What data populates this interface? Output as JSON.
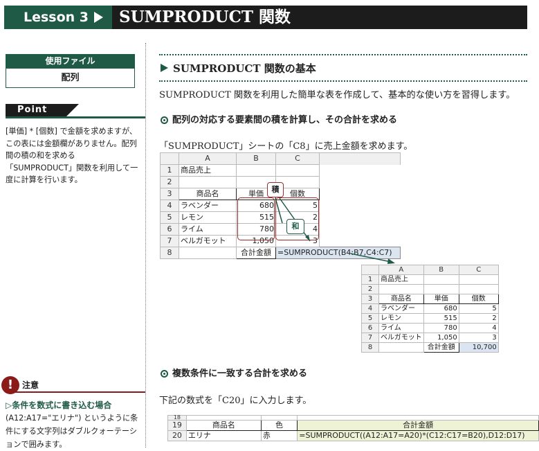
{
  "header": {
    "lesson": "Lesson 3",
    "title": "SUMPRODUCT 関数"
  },
  "sidebar": {
    "file_head": "使用ファイル",
    "file_name": "配列",
    "point_label": "Point",
    "point_text": "[単価] * [個数] で金額を求めますが、この表には金額欄がありません。配列間の積の和を求める「SUMPRODUCT」関数を利用して一度に計算を行います。",
    "caution_icon": "!",
    "caution_label": "注意",
    "caution_sub": "▷条件を数式に書き込む場合",
    "caution_text": "(A12:A17=\"エリナ\") というように条件にする文字列はダブルクォーテーションで囲みます。"
  },
  "main": {
    "section_title": "SUMPRODUCT 関数の基本",
    "intro": "SUMPRODUCT 関数を利用した簡単な表を作成して、基本的な使い方を習得します。",
    "sub1": "配列の対応する要素間の積を計算し、その合計を求める",
    "desc1": "「SUMPRODUCT」シートの「C8」に売上金額を求めます。",
    "sub2": "複数条件に一致する合計を求める",
    "desc2": "下記の数式を「C20」に入力します。"
  },
  "sheet1": {
    "cols": [
      "A",
      "B",
      "C"
    ],
    "title": "商品売上",
    "headers": [
      "商品名",
      "単価",
      "個数"
    ],
    "rows": [
      {
        "n": "4",
        "name": "ラベンダー",
        "price": "680",
        "qty": "5"
      },
      {
        "n": "5",
        "name": "レモン",
        "price": "515",
        "qty": "2"
      },
      {
        "n": "6",
        "name": "ライム",
        "price": "780",
        "qty": "4"
      },
      {
        "n": "7",
        "name": "ベルガモット",
        "price": "1,050",
        "qty": "3"
      }
    ],
    "total_label": "合計金額",
    "formula": "=SUMPRODUCT(B4:B7,C4:C7)",
    "label_product": "積",
    "label_sum": "和"
  },
  "sheet2": {
    "cols": [
      "A",
      "B",
      "C"
    ],
    "title": "商品売上",
    "headers": [
      "商品名",
      "単価",
      "個数"
    ],
    "rows": [
      {
        "n": "4",
        "name": "ラベンダー",
        "price": "680",
        "qty": "5"
      },
      {
        "n": "5",
        "name": "レモン",
        "price": "515",
        "qty": "2"
      },
      {
        "n": "6",
        "name": "ライム",
        "price": "780",
        "qty": "4"
      },
      {
        "n": "7",
        "name": "ベルガモット",
        "price": "1,050",
        "qty": "3"
      }
    ],
    "total_label": "合計金額",
    "total_value": "10,700"
  },
  "sheet3": {
    "top_row": "18",
    "row19": {
      "n": "19",
      "a": "商品名",
      "b": "色",
      "c": "合計金額"
    },
    "row20": {
      "n": "20",
      "a": "エリナ",
      "b": "赤",
      "c": "=SUMPRODUCT((A12:A17=A20)*(C12:C17=B20),D12:D17)"
    }
  },
  "colors": {
    "accent": "#1f5a46",
    "header_bg": "#1c1c1c",
    "caution": "#8b1a1a",
    "highlight": "#9b2a2a",
    "total_bg": "#dbe5f1"
  }
}
